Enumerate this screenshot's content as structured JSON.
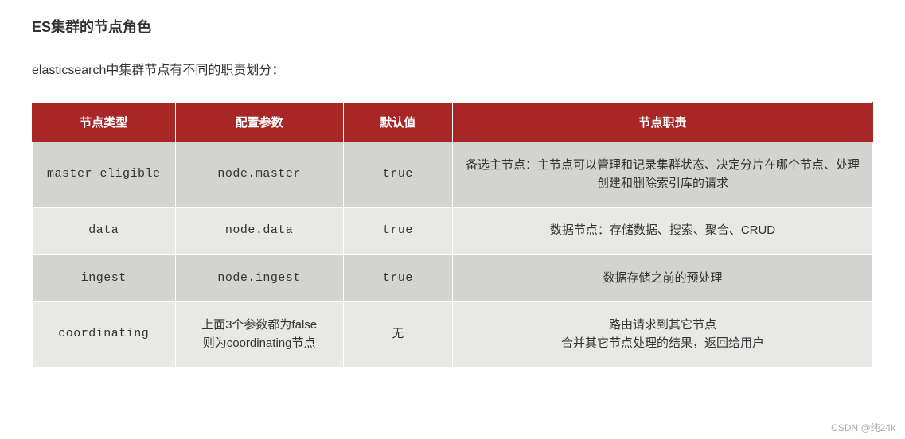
{
  "title": "ES集群的节点角色",
  "subtitle": "elasticsearch中集群节点有不同的职责划分：",
  "table": {
    "headers": {
      "type": "节点类型",
      "param": "配置参数",
      "default": "默认值",
      "duty": "节点职责"
    },
    "rows": [
      {
        "type": "master eligible",
        "param": "node.master",
        "default": "true",
        "duty": "备选主节点：主节点可以管理和记录集群状态、决定分片在哪个节点、处理创建和删除索引库的请求"
      },
      {
        "type": "data",
        "param": "node.data",
        "default": "true",
        "duty": "数据节点：存储数据、搜索、聚合、CRUD"
      },
      {
        "type": "ingest",
        "param": "node.ingest",
        "default": "true",
        "duty": "数据存储之前的预处理"
      },
      {
        "type": "coordinating",
        "param": "上面3个参数都为false\n则为coordinating节点",
        "default": "无",
        "duty": "路由请求到其它节点\n合并其它节点处理的结果，返回给用户"
      }
    ]
  },
  "watermark": "CSDN @纯24k"
}
